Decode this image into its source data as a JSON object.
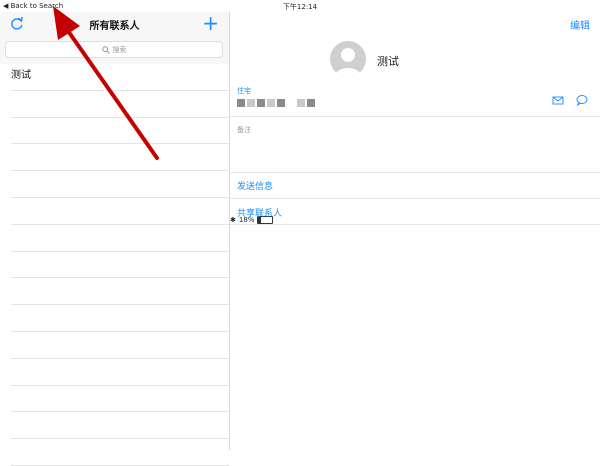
{
  "status": {
    "back_label": "Back to Search",
    "time": "下午12:14",
    "battery": "18%",
    "battery_fraction": 0.18
  },
  "left": {
    "title": "所有联系人",
    "search_placeholder": "搜索",
    "contacts": [
      "测试"
    ],
    "empty_rows": 14
  },
  "right": {
    "edit_label": "编辑",
    "contact_name": "测试",
    "home_label": "住宅",
    "notes_label": "备注",
    "send_message": "发送信息",
    "share_contact": "共享联系人"
  },
  "colors": {
    "accent": "#1a8cff"
  },
  "icons": [
    "refresh-icon",
    "plus-icon",
    "search-icon",
    "avatar-icon",
    "mail-icon",
    "message-icon",
    "bluetooth-icon",
    "battery-icon"
  ]
}
